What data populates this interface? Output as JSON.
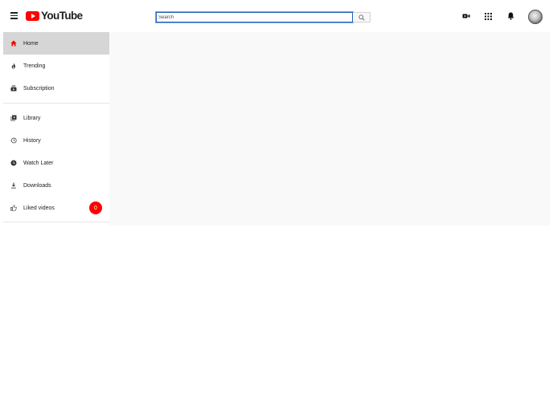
{
  "header": {
    "logo_text": "YouTube",
    "search_placeholder": "Search",
    "search_value": ""
  },
  "sidebar": {
    "main_items": [
      {
        "label": "Home",
        "icon": "home-icon",
        "active": true
      },
      {
        "label": "Trending",
        "icon": "flame-icon"
      },
      {
        "label": "Subscription",
        "icon": "subscriptions-icon"
      }
    ],
    "library_items": [
      {
        "label": "Library",
        "icon": "library-icon"
      },
      {
        "label": "History",
        "icon": "history-icon"
      },
      {
        "label": "Watch Later",
        "icon": "clock-icon"
      },
      {
        "label": "Downloads",
        "icon": "download-icon"
      },
      {
        "label": "Liked videos",
        "icon": "thumbs-up-icon",
        "badge": "0"
      }
    ]
  },
  "colors": {
    "brand": "#ff0000",
    "active_item_bg": "#d6d6d6",
    "search_focus": "#1c62b9",
    "content_bg": "#f9f9f9"
  }
}
